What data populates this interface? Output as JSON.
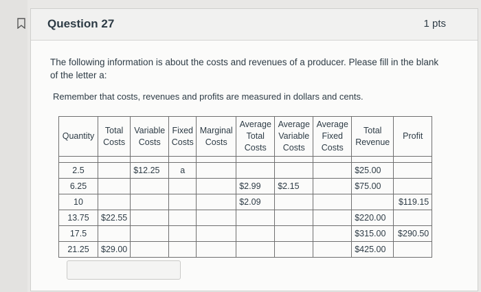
{
  "question": {
    "title": "Question 27",
    "points": "1 pts",
    "prompt": "The following information is about the costs and revenues of a producer. Please fill in the blank of the letter a:",
    "reminder": "Remember that costs, revenues and profits are measured in dollars and cents."
  },
  "table": {
    "headers": {
      "quantity": "Quantity",
      "total_costs": [
        "Total",
        "Costs"
      ],
      "variable_costs": [
        "Variable",
        "Costs"
      ],
      "fixed_costs": [
        "Fixed",
        "Costs"
      ],
      "marginal_costs": [
        "Marginal",
        "Costs"
      ],
      "avg_total_costs": [
        "Average",
        "Total",
        "Costs"
      ],
      "avg_variable_costs": [
        "Average",
        "Variable",
        "Costs"
      ],
      "avg_fixed_costs": [
        "Average",
        "Fixed",
        "Costs"
      ],
      "total_revenue": [
        "Total",
        "Revenue"
      ],
      "profit": "Profit"
    },
    "rows": [
      [
        "2.5",
        "",
        "$12.25",
        "a",
        "",
        "",
        "",
        "",
        "$25.00",
        ""
      ],
      [
        "6.25",
        "",
        "",
        "",
        "",
        "$2.99",
        "$2.15",
        "",
        "$75.00",
        ""
      ],
      [
        "10",
        "",
        "",
        "",
        "",
        "$2.09",
        "",
        "",
        "",
        "$119.15"
      ],
      [
        "13.75",
        "$22.55",
        "",
        "",
        "",
        "",
        "",
        "",
        "$220.00",
        ""
      ],
      [
        "17.5",
        "",
        "",
        "",
        "",
        "",
        "",
        "",
        "$315.00",
        "$290.50"
      ],
      [
        "21.25",
        "$29.00",
        "",
        "",
        "",
        "",
        "",
        "",
        "$425.00",
        ""
      ]
    ]
  },
  "answer": {
    "value": ""
  }
}
